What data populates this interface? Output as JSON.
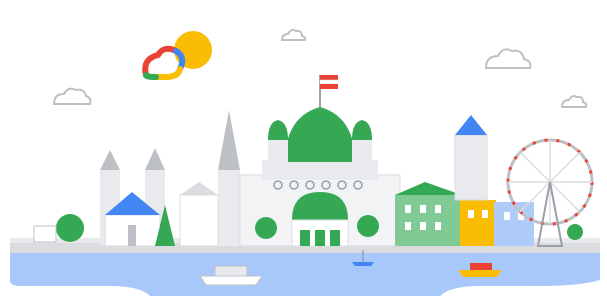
{
  "illustration": {
    "theme": "vienna-skyline-with-cloud-logo",
    "colors": {
      "sky": "#ffffff",
      "water": "#a8c7fa",
      "water_dark": "#8ab4f8",
      "ground": "#dadce0",
      "green": "#34a853",
      "green_dark": "#188038",
      "blue": "#4285f4",
      "blue_light": "#aecbfa",
      "yellow": "#fbbc04",
      "red": "#ea4335",
      "grey_building": "#e8eaed",
      "grey_dark": "#bdc1c6",
      "sun": "#fbbc04"
    },
    "icons": [
      "google-cloud-logo-icon",
      "sun-icon",
      "cloud-icon",
      "austrian-flag-icon",
      "ferris-wheel-icon",
      "boat-icon"
    ]
  }
}
